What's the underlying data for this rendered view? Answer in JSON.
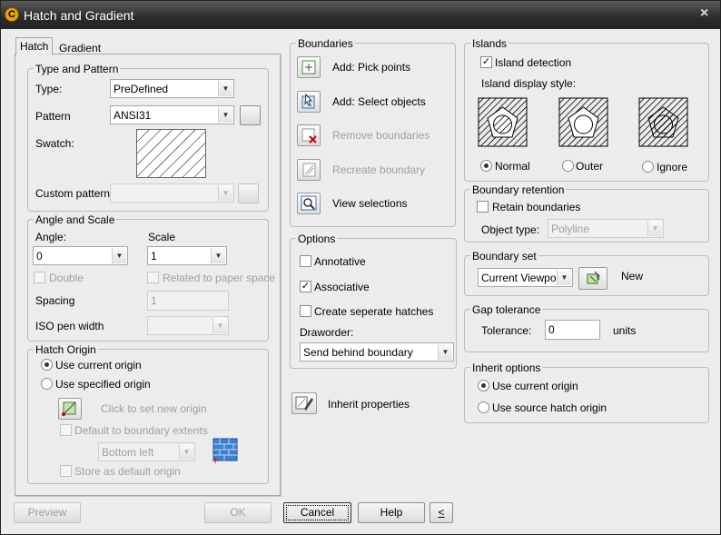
{
  "window": {
    "title": "Hatch and Gradient",
    "close_glyph": "×",
    "app_icon_letter": "C"
  },
  "tabs": [
    {
      "label": "Hatch"
    },
    {
      "label": "Gradient"
    }
  ],
  "type_pattern": {
    "legend": "Type and Pattern",
    "type_label": "Type:",
    "type_value": "PreDefined",
    "pattern_label": "Pattern",
    "pattern_value": "ANSI31",
    "swatch_label": "Swatch:",
    "custom_label": "Custom pattern:",
    "custom_value": ""
  },
  "angle_scale": {
    "legend": "Angle and Scale",
    "angle_label": "Angle:",
    "angle_value": "0",
    "scale_label": "Scale",
    "scale_value": "1",
    "double_label": "Double",
    "related_label": "Related to paper space",
    "spacing_label": "Spacing",
    "spacing_value": "1",
    "iso_label": "ISO pen width",
    "iso_value": ""
  },
  "hatch_origin": {
    "legend": "Hatch Origin",
    "use_current": "Use current origin",
    "use_specified": "Use specified origin",
    "click_to_set": "Click to set new origin",
    "default_extents": "Default to boundary extents",
    "position_value": "Bottom left",
    "store_default": "Store as default origin"
  },
  "boundaries": {
    "legend": "Boundaries",
    "add_pick": "Add: Pick points",
    "add_select": "Add: Select objects",
    "remove": "Remove boundaries",
    "recreate": "Recreate boundary",
    "view": "View selections"
  },
  "options": {
    "legend": "Options",
    "annotative": "Annotative",
    "associative": "Associative",
    "separate": "Create seperate hatches",
    "draworder_label": "Draworder:",
    "draworder_value": "Send behind boundary"
  },
  "inherit_properties": "Inherit properties",
  "islands": {
    "legend": "Islands",
    "detection": "Island detection",
    "display_style": "Island display style:",
    "normal": "Normal",
    "outer": "Outer",
    "ignore": "Ignore"
  },
  "boundary_retention": {
    "legend": "Boundary retention",
    "retain": "Retain boundaries",
    "object_type_label": "Object type:",
    "object_type_value": "Polyline"
  },
  "boundary_set": {
    "legend": "Boundary set",
    "value": "Current Viewport",
    "new_label": "New"
  },
  "gap_tolerance": {
    "legend": "Gap tolerance",
    "tolerance_label": "Tolerance:",
    "tolerance_value": "0",
    "units": "units"
  },
  "inherit_options": {
    "legend": "Inherit options",
    "use_current": "Use current origin",
    "use_source": "Use source hatch origin"
  },
  "footer": {
    "preview": "Preview",
    "ok": "OK",
    "cancel": "Cancel",
    "help": "Help",
    "more": "<"
  },
  "colors": {
    "accent_blue": "#1f5fbf",
    "disabled_text": "#a0a0a0",
    "titlebar": "#2b2b2b"
  }
}
